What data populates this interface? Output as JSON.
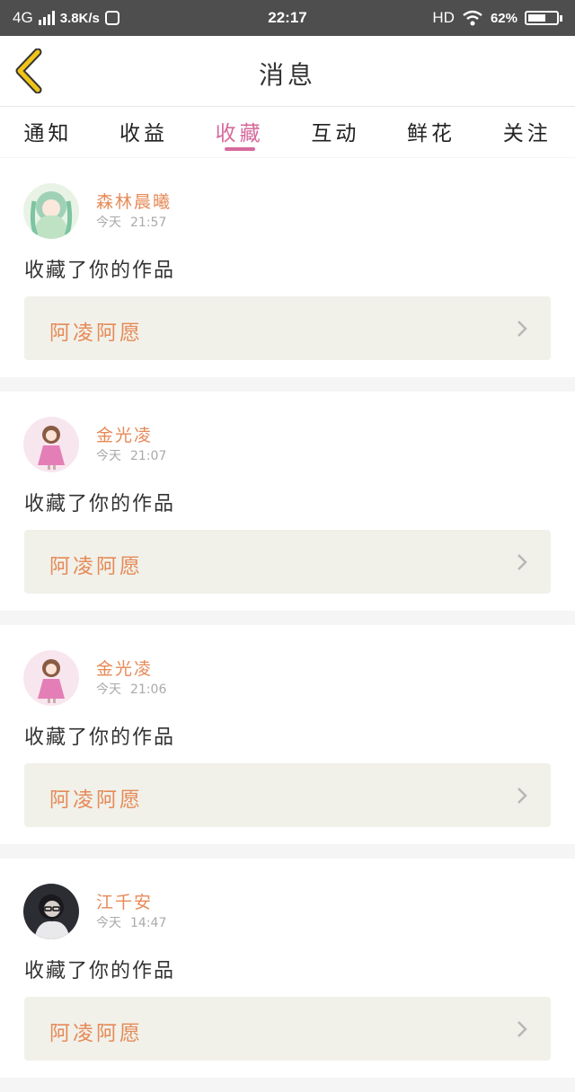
{
  "status_bar": {
    "network": "4G",
    "speed": "3.8K/s",
    "time": "22:17",
    "hd": "HD",
    "battery": "62%",
    "battery_level": 0.62
  },
  "header": {
    "title": "消息",
    "back_icon": "chevron-left-icon",
    "accent_color": "#f0c419"
  },
  "tabs": [
    {
      "label": "通知",
      "active": false
    },
    {
      "label": "收益",
      "active": false
    },
    {
      "label": "收藏",
      "active": true
    },
    {
      "label": "互动",
      "active": false
    },
    {
      "label": "鲜花",
      "active": false
    },
    {
      "label": "关注",
      "active": false
    }
  ],
  "colors": {
    "tab_active": "#d56a9b",
    "name": "#e68a57",
    "work_bg": "#f1f1ea"
  },
  "messages": [
    {
      "name": "森林晨曦",
      "day": "今天",
      "time": "21:57",
      "action": "收藏了你的作品",
      "work": "阿凌阿愿",
      "avatar": "avatar-green-hair"
    },
    {
      "name": "金光凌",
      "day": "今天",
      "time": "21:07",
      "action": "收藏了你的作品",
      "work": "阿凌阿愿",
      "avatar": "avatar-pink-dress"
    },
    {
      "name": "金光凌",
      "day": "今天",
      "time": "21:06",
      "action": "收藏了你的作品",
      "work": "阿凌阿愿",
      "avatar": "avatar-pink-dress"
    },
    {
      "name": "江千安",
      "day": "今天",
      "time": "14:47",
      "action": "收藏了你的作品",
      "work": "阿凌阿愿",
      "avatar": "avatar-dark-photo"
    }
  ]
}
